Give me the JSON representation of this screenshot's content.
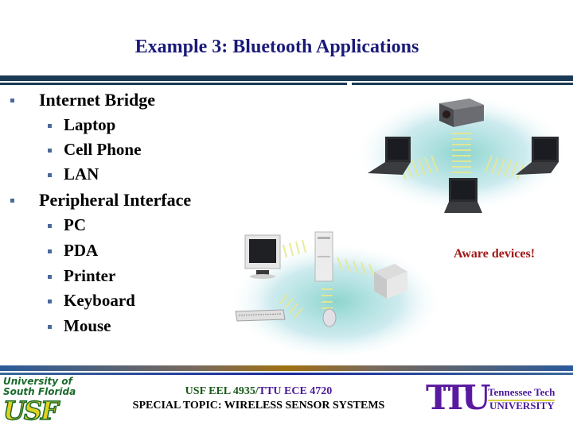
{
  "slide": {
    "title": "Example 3: Bluetooth Applications",
    "bullets": [
      {
        "label": "Internet Bridge",
        "children": [
          "Laptop",
          "Cell Phone",
          "LAN"
        ]
      },
      {
        "label": "Peripheral Interface",
        "children": [
          "PC",
          "PDA",
          "Printer",
          "Keyboard",
          "Mouse"
        ]
      }
    ],
    "callout": "Aware devices!",
    "illustrations": {
      "internet_bridge": [
        "projector-icon",
        "laptop-icon",
        "laptop-icon",
        "laptop-icon"
      ],
      "peripheral": [
        "monitor-icon",
        "pc-tower-icon",
        "printer-icon",
        "keyboard-icon",
        "mouse-icon"
      ]
    }
  },
  "footer": {
    "usf_logo": {
      "line1": "University of",
      "line2": "South Florida",
      "mark": "USF"
    },
    "course_usf": "USF EEL 4935/",
    "course_ttu": "TTU ECE 4720",
    "subtitle": "SPECIAL TOPIC: WIRELESS SENSOR SYSTEMS",
    "ttu_logo": {
      "mark": "TTU",
      "line1": "Tennessee Tech",
      "line2": "UNIVERSITY"
    }
  },
  "colors": {
    "title": "#1a1a7a",
    "rule": "#1a3a56",
    "bullet": "#4a6a9a",
    "callout": "#a01818",
    "usf_green": "#1a6a2a",
    "usf_gold": "#e0d020",
    "ttu_purple": "#4a1a9a"
  }
}
